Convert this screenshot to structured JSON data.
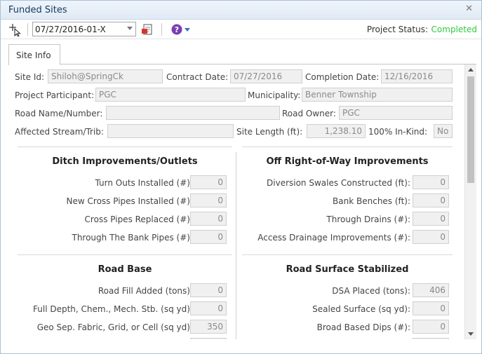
{
  "window": {
    "title": "Funded Sites"
  },
  "toolbar": {
    "select_icon": "pointer-select-icon",
    "site_selected": "07/27/2016-01-X",
    "report_icon": "pdf-report-icon",
    "help_icon": "help-icon",
    "status_label": "Project Status:",
    "status_value": "Completed",
    "status_color": "#2ecc40"
  },
  "tabs": [
    {
      "label": "Site Info"
    }
  ],
  "site_info": {
    "site_id": {
      "label": "Site Id:",
      "value": "Shiloh@SpringCk"
    },
    "contract_date": {
      "label": "Contract Date:",
      "value": "07/27/2016"
    },
    "completion_date": {
      "label": "Completion Date:",
      "value": "12/16/2016"
    },
    "project_participant": {
      "label": "Project Participant:",
      "value": "PGC"
    },
    "municipality": {
      "label": "Municipality:",
      "value": "Benner Township"
    },
    "road_name": {
      "label": "Road Name/Number:",
      "value": ""
    },
    "road_owner": {
      "label": "Road Owner:",
      "value": "PGC"
    },
    "affected_stream": {
      "label": "Affected Stream/Trib:",
      "value": ""
    },
    "site_length": {
      "label": "Site Length (ft):",
      "value": "1,238.10"
    },
    "in_kind": {
      "label": "100% In-Kind:",
      "value": "No"
    }
  },
  "sections": {
    "ditch": {
      "title": "Ditch Improvements/Outlets",
      "rows": [
        {
          "label": "Turn Outs Installed (#):",
          "value": "0"
        },
        {
          "label": "New Cross Pipes Installed (#):",
          "value": "0"
        },
        {
          "label": "Cross Pipes Replaced (#):",
          "value": "0"
        },
        {
          "label": "Through The Bank Pipes (#):",
          "value": "0"
        }
      ]
    },
    "off_row": {
      "title": "Off Right-of-Way Improvements",
      "rows": [
        {
          "label": "Diversion Swales Constructed (ft):",
          "value": "0"
        },
        {
          "label": "Bank Benches (ft):",
          "value": "0"
        },
        {
          "label": "Through Drains (#):",
          "value": "0"
        },
        {
          "label": "Access Drainage Improvements (#):",
          "value": "0"
        }
      ]
    },
    "road_base": {
      "title": "Road Base",
      "rows": [
        {
          "label": "Road Fill Added (tons):",
          "value": "0"
        },
        {
          "label": "Full Depth, Chem., Mech. Stb. (sq yd):",
          "value": "0"
        },
        {
          "label": "Geo Sep. Fabric, Grid, or Cell (sq yd):",
          "value": "350"
        }
      ]
    },
    "road_surface": {
      "title": "Road Surface Stabilized",
      "rows": [
        {
          "label": "DSA Placed (tons):",
          "value": "406"
        },
        {
          "label": "Sealed Surface (sq yd):",
          "value": "0"
        },
        {
          "label": "Broad Based Dips (#):",
          "value": "0"
        }
      ]
    }
  }
}
